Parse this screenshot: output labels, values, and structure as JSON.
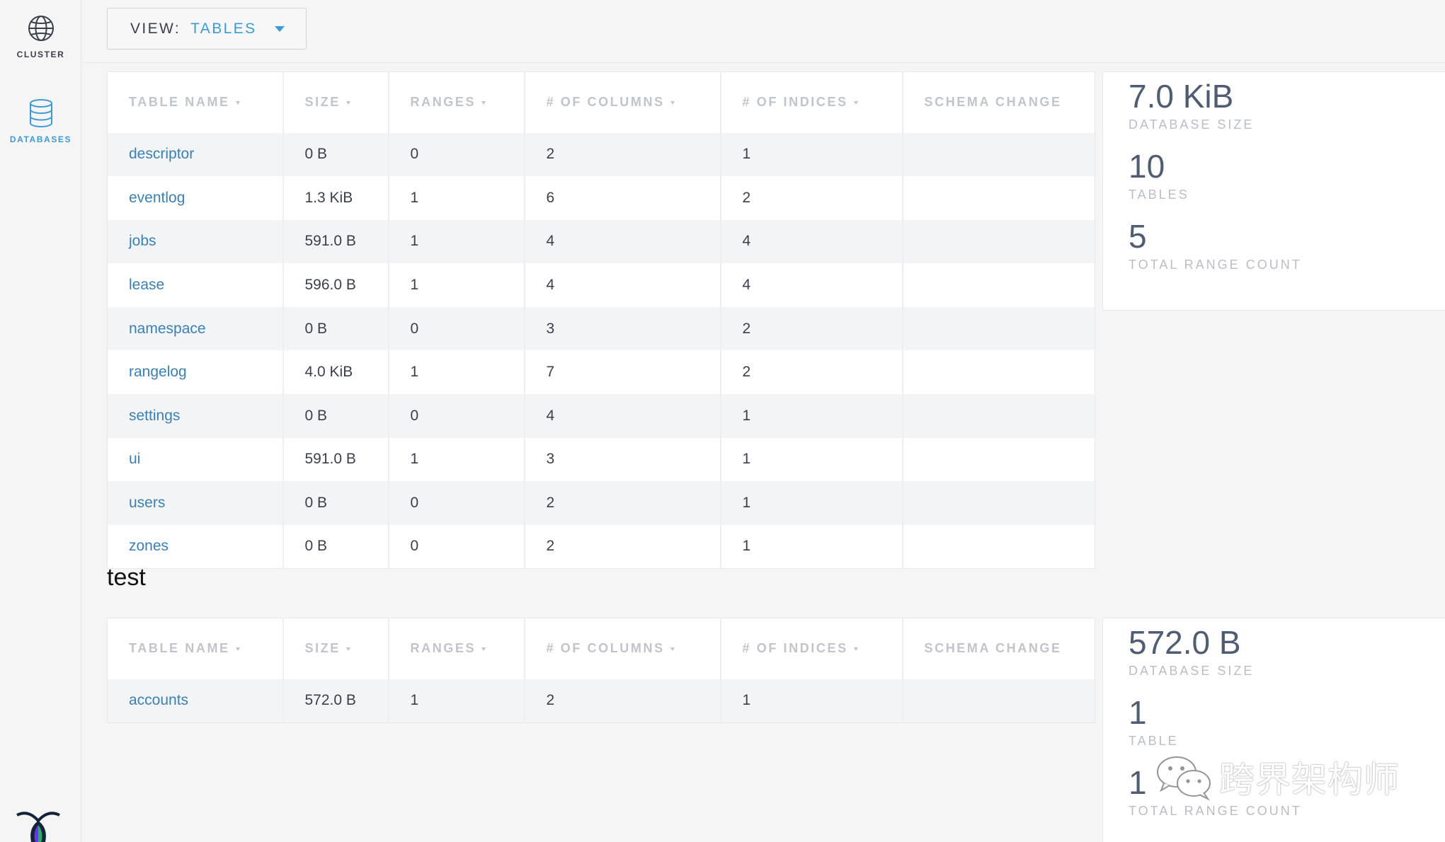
{
  "sidebar": {
    "items": [
      {
        "label": "CLUSTER",
        "icon": "globe-icon",
        "active": false
      },
      {
        "label": "DATABASES",
        "icon": "database-icon",
        "active": true
      }
    ]
  },
  "view_selector": {
    "label": "VIEW:",
    "value": "TABLES"
  },
  "columns": {
    "table_name": "TABLE NAME",
    "size": "SIZE",
    "ranges": "RANGES",
    "columns": "# OF COLUMNS",
    "indices": "# OF INDICES",
    "schema_change": "SCHEMA CHANGE"
  },
  "databases": [
    {
      "name": "",
      "tables": [
        {
          "name": "descriptor",
          "size": "0 B",
          "ranges": "0",
          "columns": "2",
          "indices": "1",
          "schema_change": ""
        },
        {
          "name": "eventlog",
          "size": "1.3 KiB",
          "ranges": "1",
          "columns": "6",
          "indices": "2",
          "schema_change": ""
        },
        {
          "name": "jobs",
          "size": "591.0 B",
          "ranges": "1",
          "columns": "4",
          "indices": "4",
          "schema_change": ""
        },
        {
          "name": "lease",
          "size": "596.0 B",
          "ranges": "1",
          "columns": "4",
          "indices": "4",
          "schema_change": ""
        },
        {
          "name": "namespace",
          "size": "0 B",
          "ranges": "0",
          "columns": "3",
          "indices": "2",
          "schema_change": ""
        },
        {
          "name": "rangelog",
          "size": "4.0 KiB",
          "ranges": "1",
          "columns": "7",
          "indices": "2",
          "schema_change": ""
        },
        {
          "name": "settings",
          "size": "0 B",
          "ranges": "0",
          "columns": "4",
          "indices": "1",
          "schema_change": ""
        },
        {
          "name": "ui",
          "size": "591.0 B",
          "ranges": "1",
          "columns": "3",
          "indices": "1",
          "schema_change": ""
        },
        {
          "name": "users",
          "size": "0 B",
          "ranges": "0",
          "columns": "2",
          "indices": "1",
          "schema_change": ""
        },
        {
          "name": "zones",
          "size": "0 B",
          "ranges": "0",
          "columns": "2",
          "indices": "1",
          "schema_change": ""
        }
      ],
      "summary": {
        "database_size": "7.0 KiB",
        "database_size_label": "DATABASE SIZE",
        "tables": "10",
        "tables_label": "TABLES",
        "range_count": "5",
        "range_count_label": "TOTAL RANGE COUNT"
      }
    },
    {
      "name": "test",
      "tables": [
        {
          "name": "accounts",
          "size": "572.0 B",
          "ranges": "1",
          "columns": "2",
          "indices": "1",
          "schema_change": ""
        }
      ],
      "summary": {
        "database_size": "572.0 B",
        "database_size_label": "DATABASE SIZE",
        "tables": "1",
        "tables_label": "TABLE",
        "range_count": "1",
        "range_count_label": "TOTAL RANGE COUNT"
      }
    }
  ],
  "watermark": {
    "text": "跨界架构师",
    "icon": "wechat-icon"
  },
  "colors": {
    "accent": "#3a9bd9",
    "link": "#3a80b8",
    "stat_value": "#4f5d74",
    "header_text": "#c0c4cb",
    "background": "#f5f5f5"
  }
}
